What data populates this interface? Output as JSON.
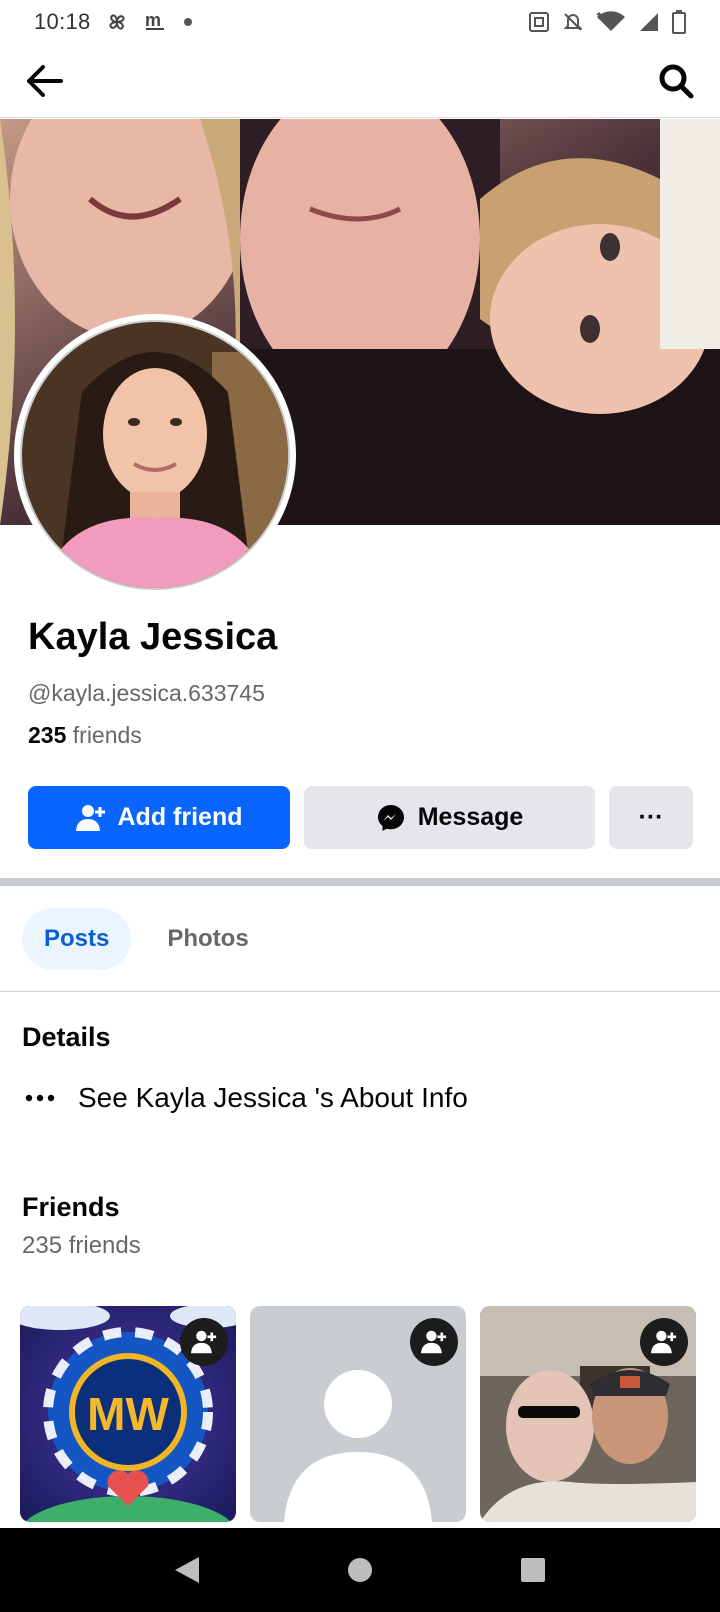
{
  "status_bar": {
    "time": "10:18",
    "left_icons": [
      "pinwheel-icon",
      "m-zone-icon",
      "dot-icon"
    ],
    "right_icons": [
      "nfc-icon",
      "mute-icon",
      "wifi-icon",
      "signal-icon",
      "battery-icon"
    ]
  },
  "header": {
    "back_icon": "arrow-left-icon",
    "search_icon": "search-icon"
  },
  "profile": {
    "name": "Kayla Jessica",
    "handle": "@kayla.jessica.633745",
    "friends_count": "235",
    "friends_word": " friends"
  },
  "actions": {
    "add_friend": "Add friend",
    "message": "Message",
    "more": "···"
  },
  "tabs": [
    {
      "label": "Posts",
      "active": true
    },
    {
      "label": "Photos",
      "active": false
    }
  ],
  "details": {
    "title": "Details",
    "about_link": "See Kayla Jessica 's About Info"
  },
  "friends_section": {
    "title": "Friends",
    "count_text": "235 friends"
  },
  "colors": {
    "accent": "#0866ff",
    "tab_active_bg": "#ebf5ff",
    "tab_active_text": "#0a5fd5",
    "secondary_button": "#e4e6eb"
  }
}
